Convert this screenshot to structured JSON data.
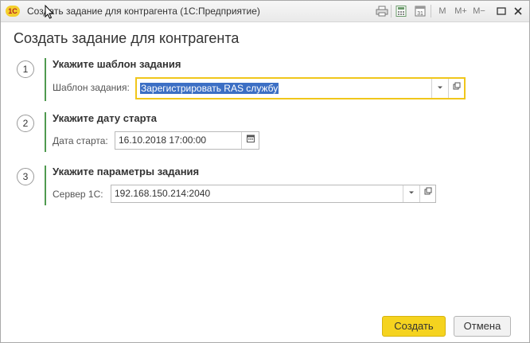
{
  "window": {
    "logo_text": "1С",
    "title": "Создать задание для контрагента  (1С:Предприятие)",
    "toolbar_icons": [
      "print-icon",
      "calculator-icon",
      "calendar-icon",
      "minimize-icon",
      "restore-icon",
      "close-icon"
    ],
    "memory_labels": [
      "M",
      "M+",
      "M−"
    ]
  },
  "form": {
    "title": "Создать задание для контрагента",
    "steps": [
      {
        "number": "1",
        "heading": "Укажите шаблон задания",
        "label": "Шаблон задания:",
        "value": "Зарегистрировать RAS службу"
      },
      {
        "number": "2",
        "heading": "Укажите дату старта",
        "label": "Дата старта:",
        "value": "16.10.2018 17:00:00"
      },
      {
        "number": "3",
        "heading": "Укажите параметры задания",
        "label": "Сервер 1С:",
        "value": "192.168.150.214:2040"
      }
    ]
  },
  "buttons": {
    "create": "Создать",
    "cancel": "Отмена"
  },
  "colors": {
    "accent_yellow": "#f5d31f",
    "step_bar_green": "#4f9a4f",
    "selection_blue": "#3c6fc4"
  }
}
